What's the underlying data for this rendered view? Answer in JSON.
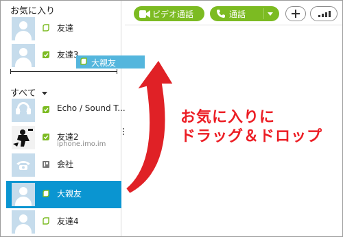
{
  "sidebar": {
    "favorites_title": "お気に入り",
    "all_title": "すべて",
    "favorites": [
      {
        "name": "友達",
        "status": "away"
      },
      {
        "name": "友達3",
        "status": "online"
      }
    ],
    "all": [
      {
        "name": "Echo / Sound T...",
        "status": "online",
        "avatar": "headset-icon"
      },
      {
        "name": "友達2",
        "sub": "iphone.imo.im",
        "status": "online",
        "avatar": "photo"
      },
      {
        "name": "会社",
        "status": "phone",
        "avatar": "phone-icon"
      },
      {
        "name": "大親友",
        "status": "away",
        "selected": true
      },
      {
        "name": "友達4",
        "status": "away"
      }
    ],
    "drag_ghost": {
      "name": "大親友"
    }
  },
  "toolbar": {
    "video_call_label": "ビデオ通話",
    "call_label": "通話"
  },
  "annotation": {
    "line1": "お気に入りに",
    "line2": "ドラッグ＆ドロップ"
  },
  "colors": {
    "accent_green": "#7cbb22",
    "selected_blue": "#0a95d1",
    "drag_blue": "#54b6dd",
    "annotation_red": "#ec1d24"
  }
}
